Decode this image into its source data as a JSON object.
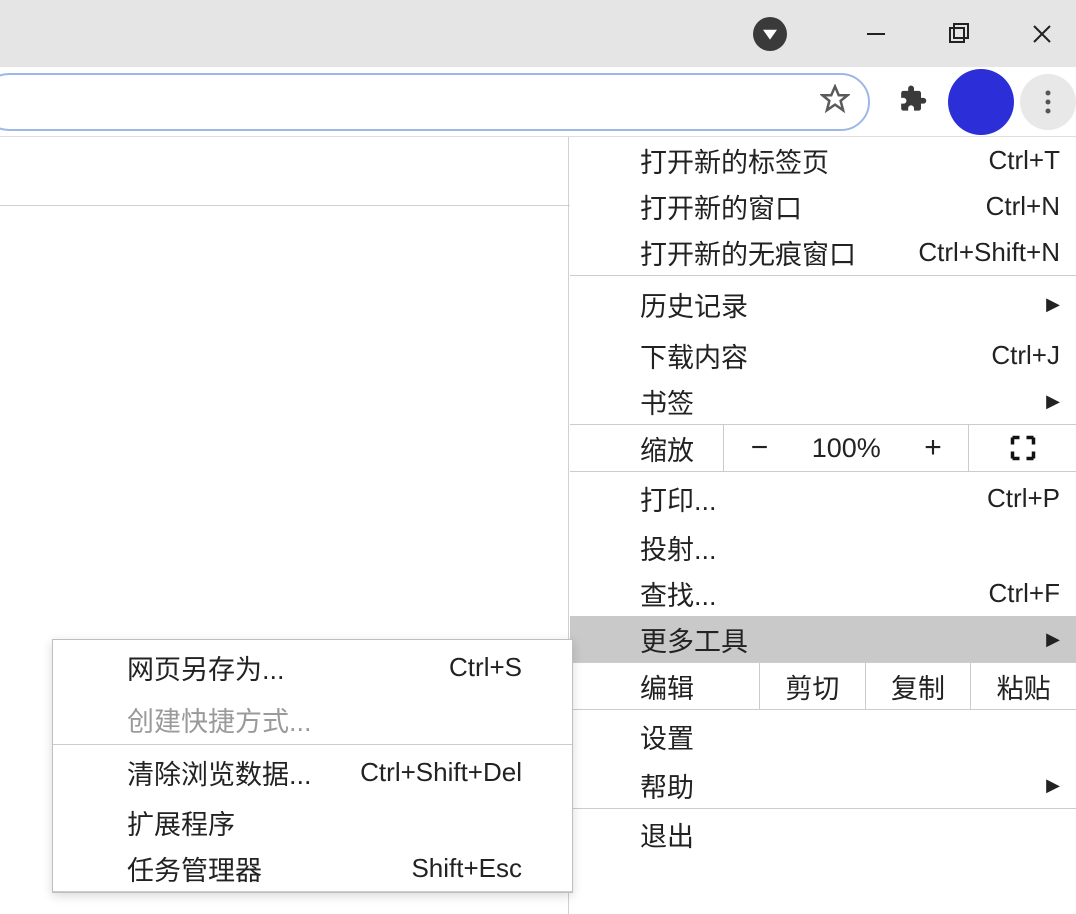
{
  "window_controls": {
    "minimize": "minimize",
    "maximize": "maximize",
    "close": "close"
  },
  "menu": {
    "new_tab": {
      "label": "打开新的标签页",
      "shortcut": "Ctrl+T"
    },
    "new_window": {
      "label": "打开新的窗口",
      "shortcut": "Ctrl+N"
    },
    "new_incognito": {
      "label": "打开新的无痕窗口",
      "shortcut": "Ctrl+Shift+N"
    },
    "history": {
      "label": "历史记录"
    },
    "downloads": {
      "label": "下载内容",
      "shortcut": "Ctrl+J"
    },
    "bookmarks": {
      "label": "书签"
    },
    "zoom": {
      "label": "缩放",
      "value": "100%",
      "minus": "−",
      "plus": "+"
    },
    "print": {
      "label": "打印...",
      "shortcut": "Ctrl+P"
    },
    "cast": {
      "label": "投射..."
    },
    "find": {
      "label": "查找...",
      "shortcut": "Ctrl+F"
    },
    "more_tools": {
      "label": "更多工具"
    },
    "edit": {
      "label": "编辑",
      "cut": "剪切",
      "copy": "复制",
      "paste": "粘贴"
    },
    "settings": {
      "label": "设置"
    },
    "help": {
      "label": "帮助"
    },
    "exit": {
      "label": "退出"
    }
  },
  "submenu": {
    "save_as": {
      "label": "网页另存为...",
      "shortcut": "Ctrl+S"
    },
    "create_shortcut": {
      "label": "创建快捷方式..."
    },
    "clear_data": {
      "label": "清除浏览数据...",
      "shortcut": "Ctrl+Shift+Del"
    },
    "extensions": {
      "label": "扩展程序"
    },
    "task_manager": {
      "label": "任务管理器",
      "shortcut": "Shift+Esc"
    }
  }
}
